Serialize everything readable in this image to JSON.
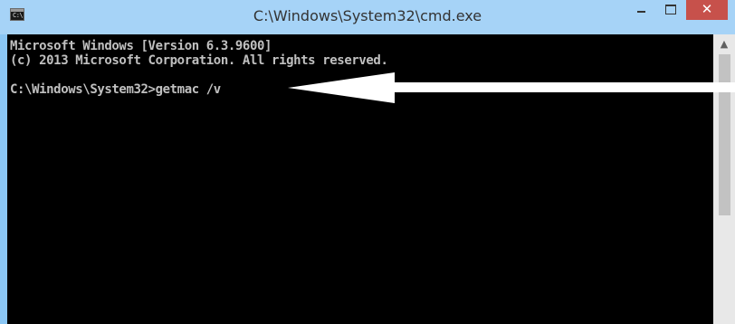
{
  "window": {
    "title": "C:\\Windows\\System32\\cmd.exe",
    "app_icon_text": "C:\\",
    "buttons": {
      "minimize_icon": "minimize-icon",
      "maximize_icon": "maximize-icon",
      "close_label": "✕"
    }
  },
  "console": {
    "lines": [
      "Microsoft Windows [Version 6.3.9600]",
      "(c) 2013 Microsoft Corporation. All rights reserved.",
      "C:\\Windows\\System32>getmac /v"
    ],
    "background_color": "#000000",
    "text_color": "#c0c0c0"
  },
  "scrollbar": {
    "up_arrow": "▲"
  },
  "annotation": {
    "type": "arrow",
    "color": "#ffffff"
  }
}
